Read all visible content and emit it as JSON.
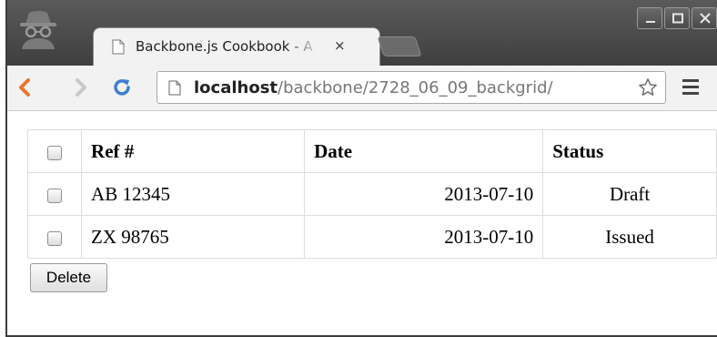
{
  "browser": {
    "tab_title": "Backbone.js Cookbook - A",
    "tab_close": "×",
    "url_host": "localhost",
    "url_path": "/backbone/2728_06_09_backgrid/"
  },
  "grid": {
    "headers": {
      "ref": "Ref #",
      "date": "Date",
      "status": "Status"
    },
    "rows": [
      {
        "ref": "AB 12345",
        "date": "2013-07-10",
        "status": "Draft"
      },
      {
        "ref": "ZX 98765",
        "date": "2013-07-10",
        "status": "Issued"
      }
    ]
  },
  "actions": {
    "delete_label": "Delete"
  },
  "icons": {
    "incognito": "incognito-icon",
    "page": "page-icon",
    "back": "back-arrow-icon",
    "forward": "forward-arrow-icon",
    "reload": "reload-icon",
    "star": "star-icon",
    "menu": "hamburger-menu-icon",
    "minimize": "minimize-icon",
    "maximize": "maximize-icon",
    "close": "close-icon"
  },
  "colors": {
    "back_arrow": "#e8762d",
    "reload": "#3f7fd0",
    "titlebar": "#4a4a4a"
  }
}
